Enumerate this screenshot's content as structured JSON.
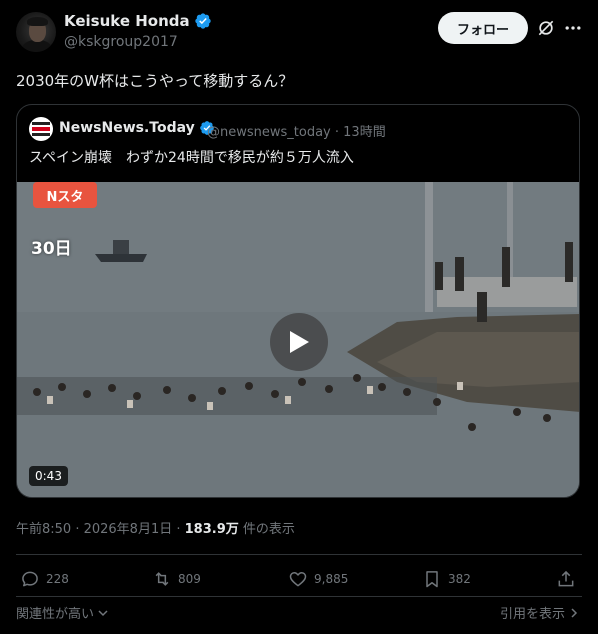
{
  "author": {
    "name": "Keisuke Honda",
    "handle": "@kskgroup2017",
    "follow_label": "フォロー"
  },
  "tweet": {
    "text": "2030年のW杯はこうやって移動するん？"
  },
  "quote": {
    "name": "NewsNews.Today",
    "handle": "@newsnews_today",
    "time": "· 13時間",
    "text": "スペイン崩壊　わずか24時間で移民が約５万人流入",
    "video": {
      "badge": "Nスタ",
      "day_label": "30日",
      "duration": "0:43"
    }
  },
  "meta": {
    "time_date": "午前8:50 · 2026年8月1日 · ",
    "views_count": "183.9万",
    "views_suffix": " 件の表示"
  },
  "actions": {
    "reply": "228",
    "retweet": "809",
    "like": "9,885",
    "bookmark": "382"
  },
  "footer": {
    "sort_label": "関連性が高い",
    "quotes_label": "引用を表示"
  },
  "colors": {
    "verified": "#1d9bf0",
    "background": "#000000",
    "border": "#2f3336",
    "muted": "#71767b",
    "badge": "#e8543f"
  }
}
